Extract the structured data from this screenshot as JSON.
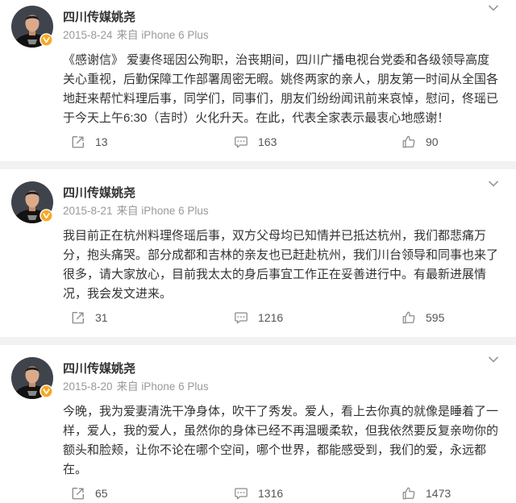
{
  "colors": {
    "page_background": "#f2f2f2",
    "card_background": "#ffffff",
    "text_primary": "#333333",
    "text_secondary": "#999999",
    "count_text": "#555555",
    "icon_gray": "#8a8a8a",
    "verified_badge": "#f7a823"
  },
  "icons": {
    "avatar": "avatar",
    "verified": "verified-badge-icon",
    "more": "chevron-down-icon",
    "repost": "repost-icon",
    "comment": "comment-icon",
    "like": "like-icon"
  },
  "posts": [
    {
      "author": "四川传媒姚尧",
      "date": "2015-8-24",
      "source": "来自 iPhone 6 Plus",
      "body_lines": [
        "《感谢信》 爱妻佟瑶因公殉职，治丧期间，四川广播电视台党委和各级领导高度",
        "关心重视，后勤保障工作部署周密无暇。姚佟两家的亲人，朋友第一时间从全国各",
        "地赶来帮忙料理后事，同学们，同事们，朋友们纷纷闻讯前来哀悼，慰问，佟瑶已",
        "于今天上午6:30（吉时）火化升天。在此，代表全家表示最衷心地感谢！"
      ],
      "reposts": "13",
      "comments": "163",
      "likes": "90"
    },
    {
      "author": "四川传媒姚尧",
      "date": "2015-8-21",
      "source": "来自 iPhone 6 Plus",
      "body_lines": [
        "我目前正在杭州料理佟瑶后事，双方父母均已知情并已抵达杭州，我们都悲痛万",
        "分，抱头痛哭。部分成都和吉林的亲友也已赶赴杭州，我们川台领导和同事也来了",
        "很多，请大家放心，目前我太太的身后事宜工作正在妥善进行中。有最新进展情",
        "况，我会发文进来。"
      ],
      "reposts": "31",
      "comments": "1216",
      "likes": "595"
    },
    {
      "author": "四川传媒姚尧",
      "date": "2015-8-20",
      "source": "来自 iPhone 6 Plus",
      "body_lines": [
        "今晚，我为爱妻清洗干净身体，吹干了秀发。爱人，看上去你真的就像是睡着了一",
        "样，爱人，我的爱人，虽然你的身体已经不再温暖柔软，但我依然要反复亲吻你的",
        "额头和脸颊，让你不论在哪个空间，哪个世界，都能感受到，我们的爱，永远都",
        "在。"
      ],
      "reposts": "65",
      "comments": "1316",
      "likes": "1473"
    }
  ]
}
